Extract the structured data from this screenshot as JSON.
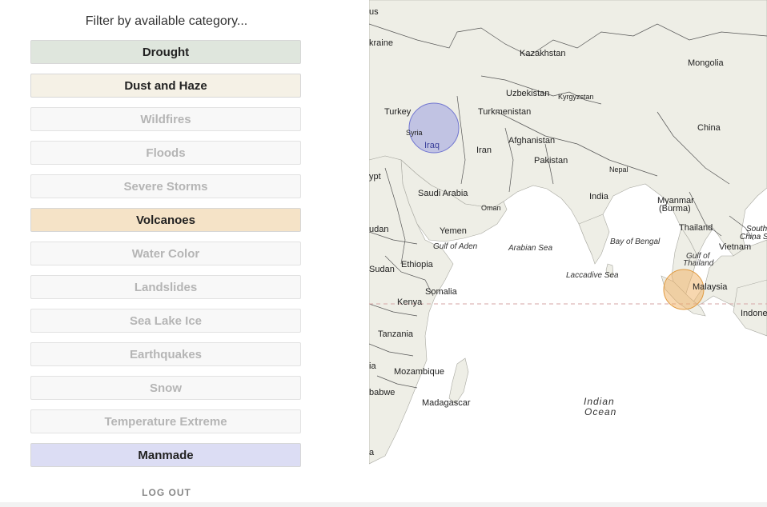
{
  "filter": {
    "title": "Filter by available category...",
    "categories": [
      {
        "label": "Drought",
        "active": true,
        "color": "#dfe6dd"
      },
      {
        "label": "Dust and Haze",
        "active": true,
        "color": "#f5f1e6"
      },
      {
        "label": "Wildfires",
        "active": false
      },
      {
        "label": "Floods",
        "active": false
      },
      {
        "label": "Severe Storms",
        "active": false
      },
      {
        "label": "Volcanoes",
        "active": true,
        "color": "#f5e3c7"
      },
      {
        "label": "Water Color",
        "active": false
      },
      {
        "label": "Landslides",
        "active": false
      },
      {
        "label": "Sea Lake Ice",
        "active": false
      },
      {
        "label": "Earthquakes",
        "active": false
      },
      {
        "label": "Snow",
        "active": false
      },
      {
        "label": "Temperature Extreme",
        "active": false
      },
      {
        "label": "Manmade",
        "active": true,
        "color": "#dcddf4"
      }
    ],
    "logout": "LOG OUT"
  },
  "map": {
    "labels": {
      "us": "us",
      "ukraine": "kraine",
      "kazakhstan": "Kazakhstan",
      "mongolia": "Mongolia",
      "uzbekistan": "Uzbekistan",
      "kyrgyzstan": "Kyrgyzstan",
      "turkey": "Turkey",
      "turkmenistan": "Turkmenistan",
      "syria": "Syria",
      "iraq": "Iraq",
      "iran": "Iran",
      "afghanistan": "Afghanistan",
      "china": "China",
      "pakistan": "Pakistan",
      "nepal": "Nepal",
      "egypt": "ypt",
      "saudi": "Saudi Arabia",
      "india": "India",
      "oman": "Oman",
      "myanmar1": "Myanmar",
      "myanmar2": "(Burma)",
      "sudan": "udan",
      "yemen": "Yemen",
      "thailand": "Thailand",
      "south_china1": "South",
      "south_china2": "China S",
      "vietnam": "Vietnam",
      "gulf_thailand1": "Gulf of",
      "gulf_thailand2": "Thailand",
      "s_sudan": "Sudan",
      "ethiopia": "Ethiopia",
      "somalia": "Somalia",
      "malaysia": "Malaysia",
      "kenya": "Kenya",
      "indonesia": "Indone",
      "tanzania": "Tanzania",
      "zambia": "ia",
      "mozambique": "Mozambique",
      "zimbabwe": "babwe",
      "madagascar": "Madagascar",
      "sa": "a"
    },
    "seas": {
      "gulf_aden": "Gulf of Aden",
      "arabian": "Arabian Sea",
      "bengal": "Bay of Bengal",
      "laccadive": "Laccadive Sea",
      "indian1": "Indian",
      "indian2": "Ocean"
    },
    "event_colors": {
      "manmade": "#8a8ee0",
      "volcano": "#f0b060"
    }
  }
}
